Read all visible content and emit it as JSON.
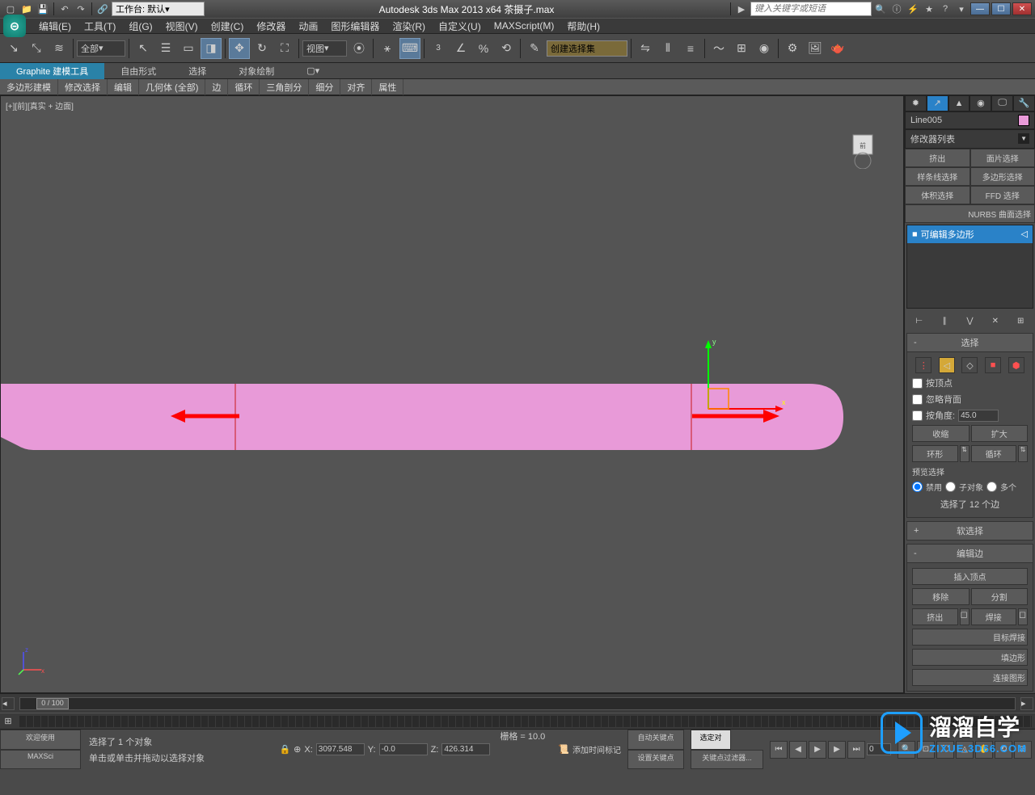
{
  "title": "Autodesk 3ds Max  2013 x64    茶摄子.max",
  "search_placeholder": "键入关键字或短语",
  "workspace_label": "工作台: 默认",
  "menus": [
    "编辑(E)",
    "工具(T)",
    "组(G)",
    "视图(V)",
    "创建(C)",
    "修改器",
    "动画",
    "图形编辑器",
    "渲染(R)",
    "自定义(U)",
    "MAXScript(M)",
    "帮助(H)"
  ],
  "selection_filter": "全部",
  "ref_coord": "视图",
  "named_sel": "创建选择集",
  "ribbon_tabs": [
    "Graphite 建模工具",
    "自由形式",
    "选择",
    "对象绘制"
  ],
  "sub_ribbon": [
    "多边形建模",
    "修改选择",
    "编辑",
    "几何体 (全部)",
    "边",
    "循环",
    "三角剖分",
    "细分",
    "对齐",
    "属性"
  ],
  "viewport_label": "[+][前][真实 + 边面]",
  "object_name": "Line005",
  "modifier_list": "修改器列表",
  "modifier_buttons": [
    [
      "挤出",
      "面片选择"
    ],
    [
      "样条线选择",
      "多边形选择"
    ],
    [
      "体积选择",
      "FFD 选择"
    ]
  ],
  "nurbs_label": "NURBS 曲面选择",
  "stack_item": "可编辑多边形",
  "rollout_selection": "选择",
  "check_vertex": "按顶点",
  "check_ignore_back": "忽略背面",
  "check_angle": "按角度:",
  "angle_value": "45.0",
  "btn_shrink": "收缩",
  "btn_grow": "扩大",
  "btn_ring": "环形",
  "btn_loop": "循环",
  "preview_sel": "预览选择",
  "radio_disabled": "禁用",
  "radio_subobj": "子对象",
  "radio_multi": "多个",
  "sel_count": "选择了 12 个边",
  "rollout_soft": "软选择",
  "rollout_edit_edge": "编辑边",
  "btn_insert_vert": "插入顶点",
  "btn_remove": "移除",
  "btn_split": "分割",
  "btn_extrude": "挤出",
  "btn_weld": "焊接",
  "btn_target_weld": "目标焊接",
  "btn_connect": "连接图形",
  "btn_chamfer_edge": "填边形",
  "time_display": "0 / 100",
  "status_welcome": "欢迎使用",
  "status_script": "MAXSci",
  "status_sel": "选择了 1 个对象",
  "status_hint": "单击或单击并拖动以选择对象",
  "coord_x": "3097.548",
  "coord_y": "-0.0",
  "coord_z": "426.314",
  "grid_label": "栅格 = 10.0",
  "add_time_tag": "添加时间标记",
  "auto_key": "自动关键点",
  "set_key": "设置关键点",
  "sel_lock": "选定对",
  "key_filter": "关键点过滤器...",
  "frame_num": "0",
  "watermark_main": "溜溜自学",
  "watermark_sub": "ZIXUE.3D66.COM"
}
